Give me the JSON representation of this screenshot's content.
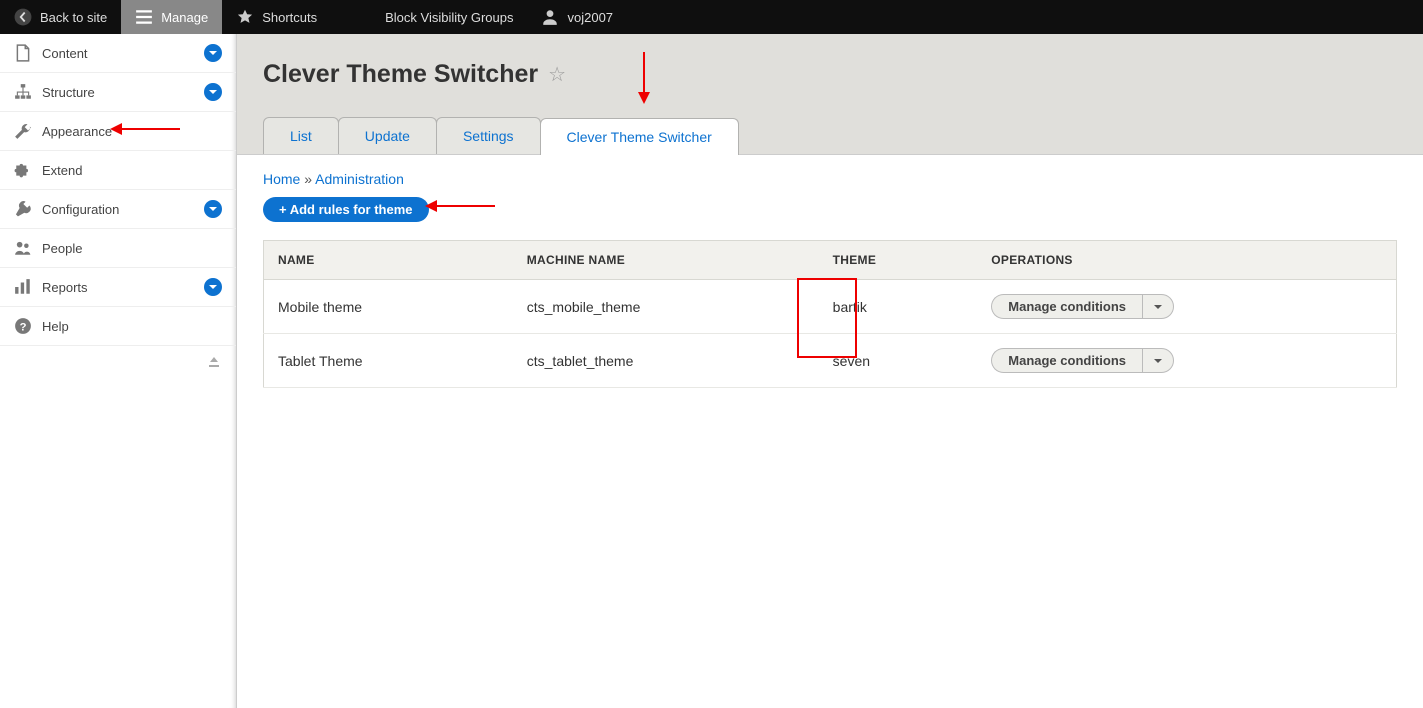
{
  "toolbar": {
    "back": "Back to site",
    "manage": "Manage",
    "shortcuts": "Shortcuts",
    "context": "Block Visibility Groups",
    "user": "voj2007"
  },
  "sidebar": {
    "items": [
      {
        "label": "Content",
        "icon": "file",
        "expandable": true
      },
      {
        "label": "Structure",
        "icon": "tree",
        "expandable": true
      },
      {
        "label": "Appearance",
        "icon": "wrench",
        "expandable": false
      },
      {
        "label": "Extend",
        "icon": "puzzle",
        "expandable": false
      },
      {
        "label": "Configuration",
        "icon": "gear",
        "expandable": true
      },
      {
        "label": "People",
        "icon": "people",
        "expandable": false
      },
      {
        "label": "Reports",
        "icon": "bars",
        "expandable": true
      },
      {
        "label": "Help",
        "icon": "help",
        "expandable": false
      }
    ]
  },
  "page": {
    "title": "Clever Theme Switcher"
  },
  "tabs": [
    {
      "label": "List"
    },
    {
      "label": "Update"
    },
    {
      "label": "Settings"
    },
    {
      "label": "Clever Theme Switcher",
      "active": true
    }
  ],
  "breadcrumb": {
    "home": "Home",
    "sep": " » ",
    "admin": "Administration"
  },
  "actions": {
    "add_rules": "+ Add rules for theme"
  },
  "table": {
    "headers": [
      "NAME",
      "MACHINE NAME",
      "THEME",
      "OPERATIONS"
    ],
    "rows": [
      {
        "name": "Mobile theme",
        "machine": "cts_mobile_theme",
        "theme": "bartik",
        "op": "Manage conditions"
      },
      {
        "name": "Tablet Theme",
        "machine": "cts_tablet_theme",
        "theme": "seven",
        "op": "Manage conditions"
      }
    ]
  }
}
